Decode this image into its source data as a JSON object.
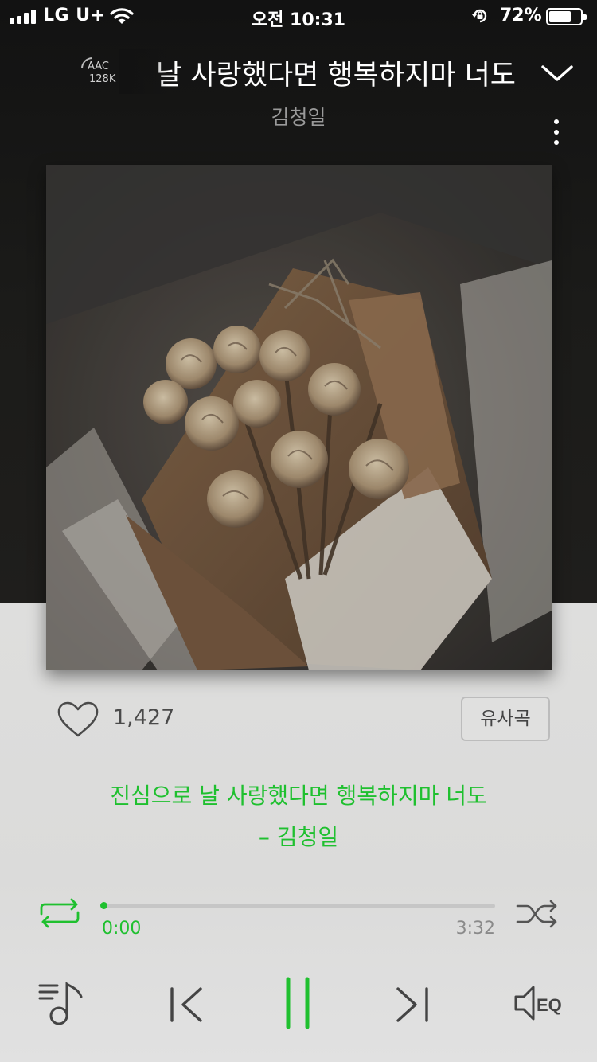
{
  "status_bar": {
    "carrier": "LG U+",
    "time": "오전 10:31",
    "battery_percent": "72%",
    "battery_level": 0.72
  },
  "header": {
    "codec_line1": "AAC",
    "codec_line2": "128K",
    "song_title": "날 사랑했다면 행복하지마 너도",
    "artist": "김청일"
  },
  "actions": {
    "like_count": "1,427",
    "similar_label": "유사곡"
  },
  "lyrics": {
    "line1": "진심으로 날 사랑했다면 행복하지마 너도",
    "line2": "– 김청일"
  },
  "progress": {
    "current": "0:00",
    "total": "3:32",
    "fraction": 0.0
  },
  "colors": {
    "accent": "#1fc02f",
    "dark_bg": "#121212",
    "light_bg": "#dcdcdb"
  },
  "icons": {
    "collapse": "chevron-down-icon",
    "more": "more-vertical-icon",
    "like": "heart-outline-icon",
    "repeat": "repeat-icon",
    "shuffle": "shuffle-icon",
    "playlist": "playlist-icon",
    "prev": "previous-icon",
    "pause": "pause-icon",
    "next": "next-icon",
    "eq": "equalizer-icon"
  }
}
